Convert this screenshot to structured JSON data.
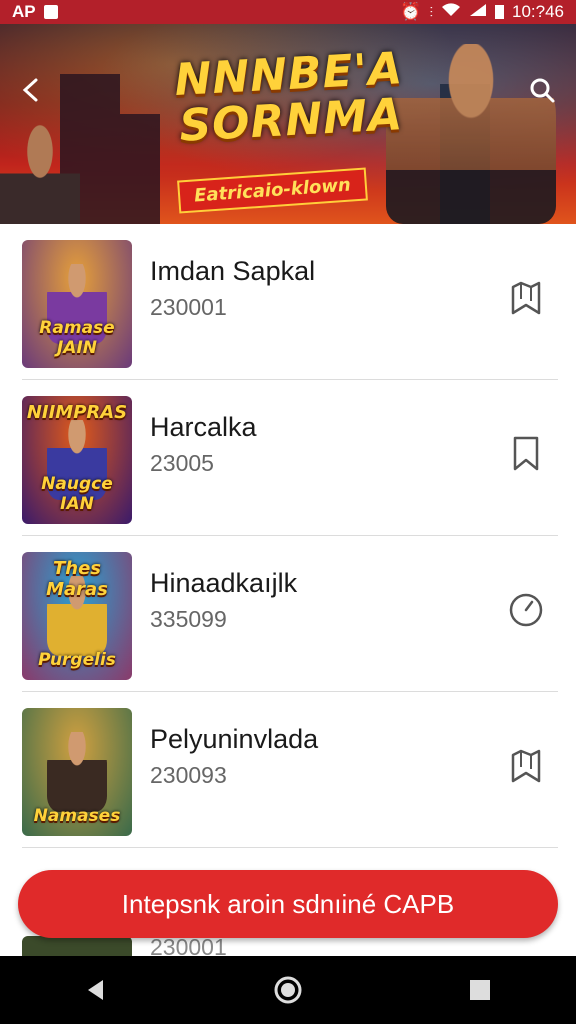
{
  "status_bar": {
    "left_text": "AP",
    "time": "10:?46",
    "icons": [
      "image-icon",
      "alarm-icon",
      "vibrate-icon",
      "wifi-icon",
      "signal-icon",
      "battery-icon"
    ]
  },
  "header": {
    "banner_title": "NNNBE'A SORNMA",
    "banner_tagline": "Eatricaio-klown",
    "back_icon": "chevron-left-icon",
    "search_icon": "search-icon"
  },
  "items": [
    {
      "name": "Imdan Sapkal",
      "number": "230001",
      "thumb_caption": "Ramase JAIN",
      "thumb_top": "",
      "action_icon": "bookmark-icon",
      "colors": {
        "bg1": "#e6a03a",
        "bg2": "#6a3a7a",
        "fig": "#7a3aa0"
      }
    },
    {
      "name": "Harcalka",
      "number": "23005",
      "thumb_caption": "Naugce IAN",
      "thumb_top": "NIIMPRAS",
      "action_icon": "bookmark-outline-icon",
      "colors": {
        "bg1": "#e05a1a",
        "bg2": "#3a1a6a",
        "fig": "#3a3aa0"
      }
    },
    {
      "name": "Hinaadkaıjlk",
      "number": "335099",
      "thumb_caption": "Purgelis",
      "thumb_top": "Thes Maras",
      "action_icon": "clock-icon",
      "colors": {
        "bg1": "#2aa0d0",
        "bg2": "#8a3a6a",
        "fig": "#e0b030"
      }
    },
    {
      "name": "Pelyuninvlada",
      "number": "230093",
      "thumb_caption": "Namases",
      "thumb_top": "",
      "action_icon": "bookmark-icon",
      "colors": {
        "bg1": "#d0a040",
        "bg2": "#3a6a4a",
        "fig": "#3a2a22"
      }
    }
  ],
  "peek_item": {
    "number": "230001"
  },
  "cta": {
    "label": "Intepsnk aroin sdnıiné CAPB"
  },
  "navbar": {
    "back": "back-triangle-icon",
    "home": "home-circle-icon",
    "recents": "recents-square-icon"
  }
}
